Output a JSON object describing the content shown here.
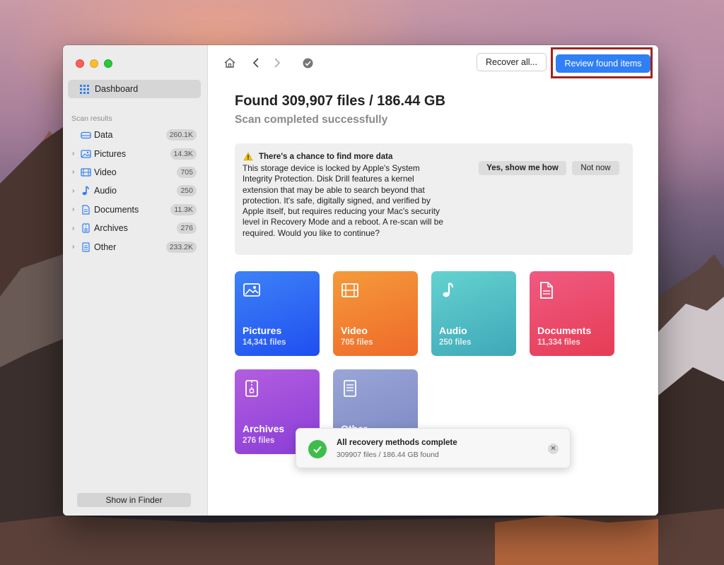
{
  "sidebar": {
    "dashboard_label": "Dashboard",
    "section_label": "Scan results",
    "items": [
      {
        "label": "Data",
        "count": "260.1K",
        "icon": "drive-icon"
      },
      {
        "label": "Pictures",
        "count": "14.3K",
        "icon": "picture-icon"
      },
      {
        "label": "Video",
        "count": "705",
        "icon": "film-icon"
      },
      {
        "label": "Audio",
        "count": "250",
        "icon": "music-note-icon"
      },
      {
        "label": "Documents",
        "count": "11.3K",
        "icon": "document-icon"
      },
      {
        "label": "Archives",
        "count": "276",
        "icon": "zip-archive-icon"
      },
      {
        "label": "Other",
        "count": "233.2K",
        "icon": "file-icon"
      }
    ],
    "show_in_finder": "Show in Finder"
  },
  "toolbar": {
    "recover_all": "Recover all...",
    "review_found": "Review found items"
  },
  "main": {
    "found_title": "Found 309,907 files / 186.44 GB",
    "found_subtitle": "Scan completed successfully"
  },
  "warning": {
    "title": "There's a chance to find more data",
    "text": "This storage device is locked by Apple's System Integrity Protection. Disk Drill features a kernel extension that may be able to search beyond that protection. It's safe, digitally signed, and verified by Apple itself, but requires reducing your Mac's security level in Recovery Mode and a reboot. A re-scan will be required. Would you like to continue?",
    "yes_label": "Yes, show me how",
    "not_now_label": "Not now"
  },
  "cards": [
    {
      "name": "Pictures",
      "count": "14,341 files",
      "color": "#2f6bf3"
    },
    {
      "name": "Video",
      "count": "705 files",
      "color": "#f07a30"
    },
    {
      "name": "Audio",
      "count": "250 files",
      "color": "#4fbfc4"
    },
    {
      "name": "Documents",
      "count": "11,334 files",
      "color": "#ea4a6a"
    },
    {
      "name": "Archives",
      "count": "276 files",
      "color": "#9a4fdc"
    },
    {
      "name": "Other",
      "count": "",
      "color": "#8a96cc"
    }
  ],
  "toast": {
    "title": "All recovery methods complete",
    "subtitle": "309907 files / 186.44 GB found"
  },
  "colors": {
    "accent": "#2f7ff5",
    "highlight_border": "#a1231d",
    "success": "#3fbd4b"
  }
}
